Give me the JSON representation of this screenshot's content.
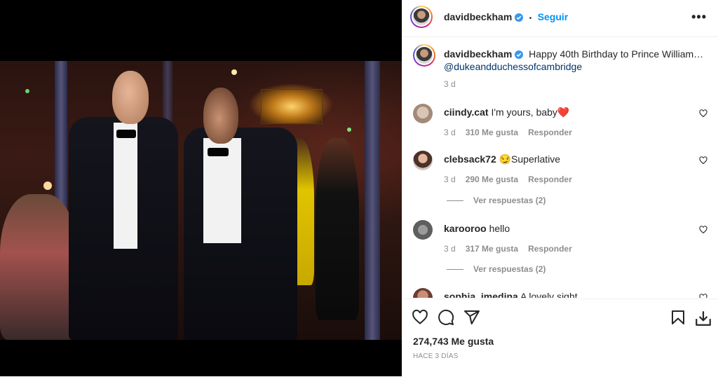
{
  "post": {
    "username": "davidbeckham",
    "follow_label": "Seguir",
    "separator": "•",
    "more_label": "•••"
  },
  "caption": {
    "username": "davidbeckham",
    "text": "Happy 40th Birthday to Prince William…",
    "mention": "@dukeandduchessofcambridge",
    "time": "3 d"
  },
  "comments": [
    {
      "username": "ciindy.cat",
      "text": "I'm yours, baby❤️",
      "time": "3 d",
      "likes": "310 Me gusta",
      "reply": "Responder"
    },
    {
      "username": "clebsack72",
      "text": "😏Superlative",
      "time": "3 d",
      "likes": "290 Me gusta",
      "reply": "Responder",
      "view_replies": "Ver respuestas (2)"
    },
    {
      "username": "karooroo",
      "text": "hello",
      "time": "3 d",
      "likes": "317 Me gusta",
      "reply": "Responder",
      "view_replies": "Ver respuestas (2)"
    },
    {
      "username": "sophia_imedina",
      "text": "A lovely sight",
      "time": "",
      "likes": "",
      "reply": ""
    }
  ],
  "footer": {
    "likes": "274,743 Me gusta",
    "ago": "HACE 3 DÍAS"
  },
  "icons": {
    "like": "heart-icon",
    "comment": "comment-icon",
    "share": "share-icon",
    "save": "bookmark-icon",
    "download": "download-icon"
  },
  "colors": {
    "link": "#0095f6",
    "mention": "#00376b",
    "muted": "#8e8e8e",
    "verified": "#3897f0"
  }
}
